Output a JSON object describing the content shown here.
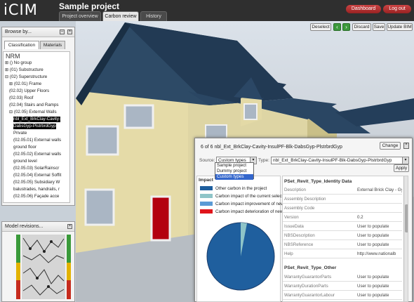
{
  "app": {
    "logo": "iCIM",
    "project_title": "Sample project"
  },
  "tabs": [
    {
      "label": "Project overview",
      "active": false
    },
    {
      "label": "Carbon review",
      "active": true
    },
    {
      "label": "History",
      "active": false
    }
  ],
  "top_buttons": {
    "dashboard": "Dashboard",
    "logout": "Log out"
  },
  "viewer_toolbar": {
    "deselect": "Deselect",
    "prev_icon": "arrow-left-icon",
    "next_icon": "arrow-right-icon",
    "discard": "Discard",
    "save": "Save",
    "update": "Update BIM"
  },
  "browse": {
    "title": "Browse by...",
    "tabs": [
      "Classification",
      "Materials"
    ],
    "section": "NRM",
    "tree": [
      {
        "label": "() No group",
        "indent": 0,
        "toggle": "+"
      },
      {
        "label": "(01) Substructure",
        "indent": 0,
        "toggle": "+"
      },
      {
        "label": "(02) Superstructure",
        "indent": 0,
        "toggle": "-"
      },
      {
        "label": "(02.01) Frame",
        "indent": 1,
        "toggle": "+"
      },
      {
        "label": "(02.02) Upper Floors",
        "indent": 1,
        "toggle": ""
      },
      {
        "label": "(02.03) Roof",
        "indent": 1,
        "toggle": ""
      },
      {
        "label": "(02.04) Stairs and Ramps",
        "indent": 1,
        "toggle": ""
      },
      {
        "label": "(02.05) External Walls",
        "indent": 1,
        "toggle": "-"
      },
      {
        "label": "nbl_Ext_BrkClay-Cavity-",
        "indent": 2,
        "toggle": "",
        "selected": true
      },
      {
        "label": "DabsGyp-PlstrbrdGyp",
        "indent": 2,
        "toggle": "",
        "selected": true
      },
      {
        "label": "Private",
        "indent": 2,
        "toggle": ""
      },
      {
        "label": "(02.05.01) External walls",
        "indent": 2,
        "toggle": ""
      },
      {
        "label": "ground floor",
        "indent": 2,
        "toggle": ""
      },
      {
        "label": "(02.05.02) External walls",
        "indent": 2,
        "toggle": ""
      },
      {
        "label": "ground level",
        "indent": 2,
        "toggle": ""
      },
      {
        "label": "(02.05.03) SolarRainscr",
        "indent": 2,
        "toggle": ""
      },
      {
        "label": "(02.05.04) External Soffit",
        "indent": 2,
        "toggle": ""
      },
      {
        "label": "(02.05.05) Subsidiary W",
        "indent": 2,
        "toggle": ""
      },
      {
        "label": "balustrades, handrails, r",
        "indent": 2,
        "toggle": ""
      },
      {
        "label": "(02.05.06) Façade acce",
        "indent": 2,
        "toggle": ""
      }
    ]
  },
  "revisions": {
    "title": "Model revisions..."
  },
  "dialog": {
    "title": "6 of 6 nbl_Ext_BrkClay-Cavity-InsulPF-Blk-DabsGyp-PlstrbrdGyp",
    "change_label": "Change",
    "source_label": "Source:",
    "source_value": "Custom types",
    "source_options": [
      "Sample project",
      "Dummy project",
      "Custom types"
    ],
    "type_label": "Type:",
    "type_value": "nbl_Ext_BrkClay-Cavity-InsulPF-Blk-DabsGyp-PlstrbrdGyp",
    "apply_label": "Apply",
    "impact_label": "Impact",
    "legend": [
      {
        "label": "Other carbon in the project",
        "color": "#1f5f9e"
      },
      {
        "label": "Carbon impact of the current selected type",
        "color": "#8ec4c8"
      },
      {
        "label": "Carbon impact improvement of new type",
        "color": "#5b9bd5"
      },
      {
        "label": "Carbon impact deterioration of new type",
        "color": "#e0141b"
      }
    ],
    "pie": {
      "other_pct": 97,
      "selected_pct": 3
    },
    "props_header1": "PSet_Revit_Type_Identity Data",
    "props1": [
      {
        "key": "Description",
        "value": "External Brick Clay - Gypsum Plasterboar"
      },
      {
        "key": "Assembly Description",
        "value": ""
      },
      {
        "key": "Assembly Code",
        "value": ""
      },
      {
        "key": "Version",
        "value": "0.2"
      },
      {
        "key": "IssueData",
        "value": "User to populate"
      },
      {
        "key": "NBSDescription",
        "value": "User to populate"
      },
      {
        "key": "NBSReference",
        "value": "User to populate"
      },
      {
        "key": "Help",
        "value": "http://www.nationalb"
      }
    ],
    "props_header2": "PSet_Revit_Type_Other",
    "props2": [
      {
        "key": "WarrantyGuarantorParts",
        "value": "User to populate"
      },
      {
        "key": "WarrantyDurationParts",
        "value": "User to populate"
      },
      {
        "key": "WarrantyGuarantorLabour",
        "value": "User to populate"
      }
    ]
  }
}
